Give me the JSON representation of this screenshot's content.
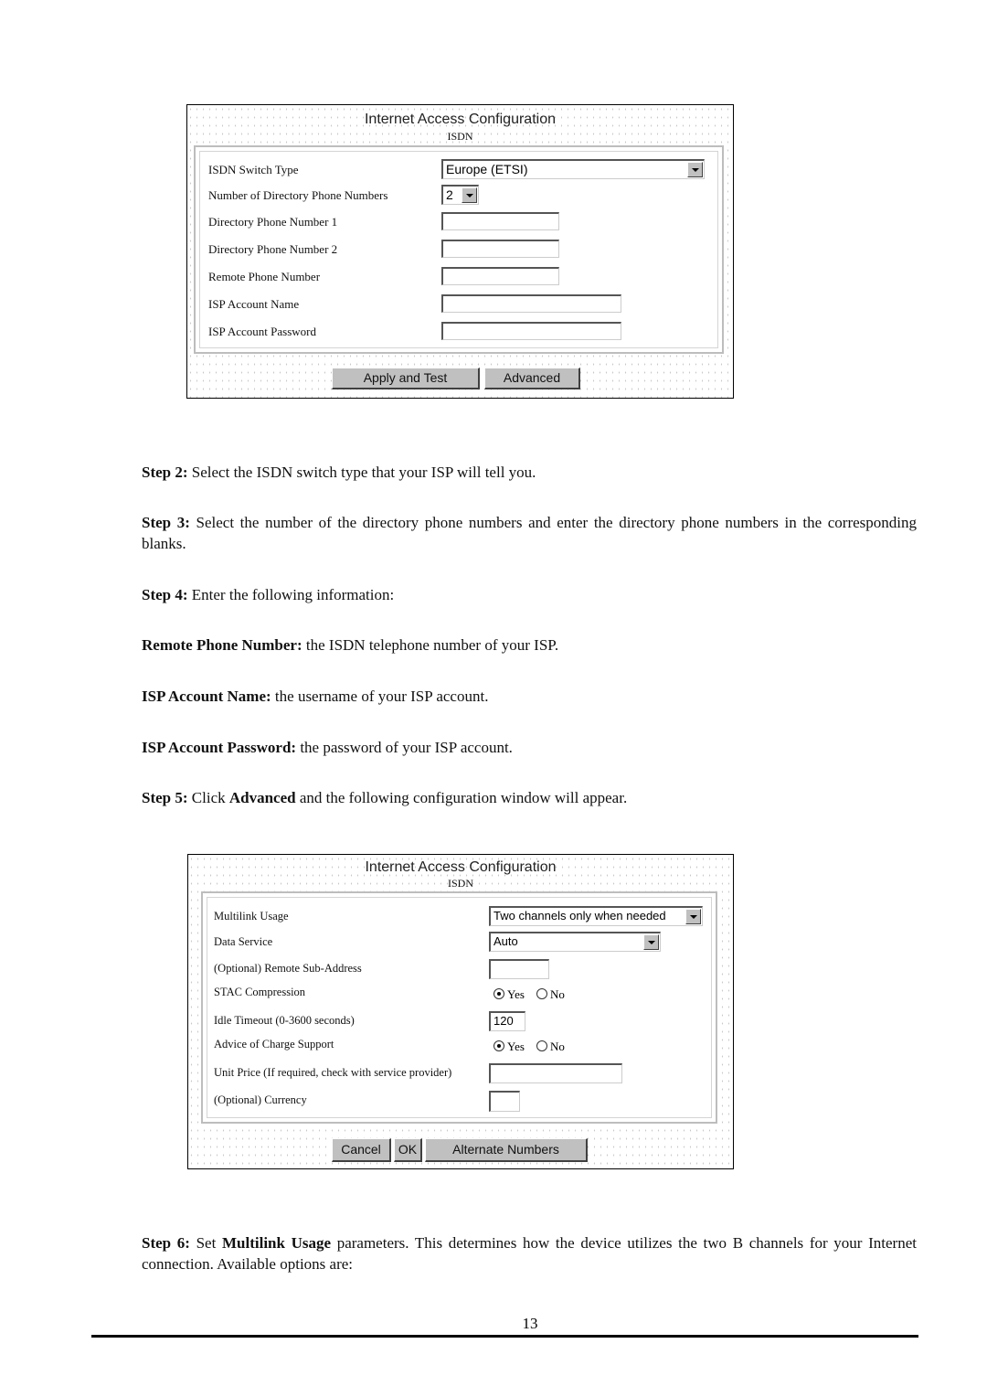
{
  "panel1": {
    "title": "Internet Access Configuration",
    "subtitle": "ISDN",
    "fields": [
      {
        "label": "ISDN Switch Type",
        "type": "select",
        "value": "Europe (ETSI)"
      },
      {
        "label": "Number of Directory Phone Numbers",
        "type": "select",
        "value": "2"
      },
      {
        "label": "Directory Phone Number 1",
        "type": "text",
        "value": ""
      },
      {
        "label": "Directory Phone Number 2",
        "type": "text",
        "value": ""
      },
      {
        "label": "Remote Phone Number",
        "type": "text",
        "value": ""
      },
      {
        "label": "ISP Account Name",
        "type": "text",
        "value": ""
      },
      {
        "label": "ISP Account Password",
        "type": "password",
        "value": ""
      }
    ],
    "buttons": {
      "apply": "Apply and Test",
      "advanced": "Advanced"
    }
  },
  "text": {
    "step2_label": "Step 2:",
    "step2": " Select the ISDN switch type that your ISP will tell you.",
    "step3_label": "Step 3:",
    "step3": " Select the number of the directory phone numbers and enter the directory phone numbers in the corresponding blanks.",
    "step4_label": "Step 4:",
    "step4": " Enter the following information:",
    "remote_label": "Remote Phone Number:",
    "remote": " the ISDN telephone number of your ISP.",
    "account_label": "ISP Account Name:",
    "account": " the username of your ISP account.",
    "password_label": "ISP Account Password:",
    "password": " the password of your ISP account.",
    "step5_label": "Step 5:",
    "step5_a": " Click ",
    "step5_bold": "Advanced",
    "step5_b": " and the following configuration window will appear.",
    "step6_label": "Step 6:",
    "step6_a": " Set ",
    "step6_bold": "Multilink Usage",
    "step6_b": " parameters. This determines how the device utilizes the two B channels for your Internet connection. Available options are:"
  },
  "panel2": {
    "title": "Internet Access Configuration",
    "subtitle": "ISDN",
    "fields": [
      {
        "label": "Multilink Usage",
        "type": "select",
        "value": "Two channels only when needed"
      },
      {
        "label": "Data Service",
        "type": "select",
        "value": "Auto"
      },
      {
        "label": "(Optional) Remote Sub-Address",
        "type": "text",
        "value": ""
      },
      {
        "label": "STAC Compression",
        "type": "radio",
        "options": [
          "Yes",
          "No"
        ],
        "selected": "Yes"
      },
      {
        "label": "Idle Timeout (0-3600 seconds)",
        "type": "text",
        "value": "120"
      },
      {
        "label": "Advice of Charge Support",
        "type": "radio",
        "options": [
          "Yes",
          "No"
        ],
        "selected": "Yes"
      },
      {
        "label": "Unit Price (If required, check with service provider)",
        "type": "text",
        "value": ""
      },
      {
        "label": "(Optional) Currency",
        "type": "text",
        "value": ""
      }
    ],
    "buttons": {
      "cancel": "Cancel",
      "ok": "OK",
      "alternate": "Alternate Numbers"
    }
  },
  "page_number": "13"
}
